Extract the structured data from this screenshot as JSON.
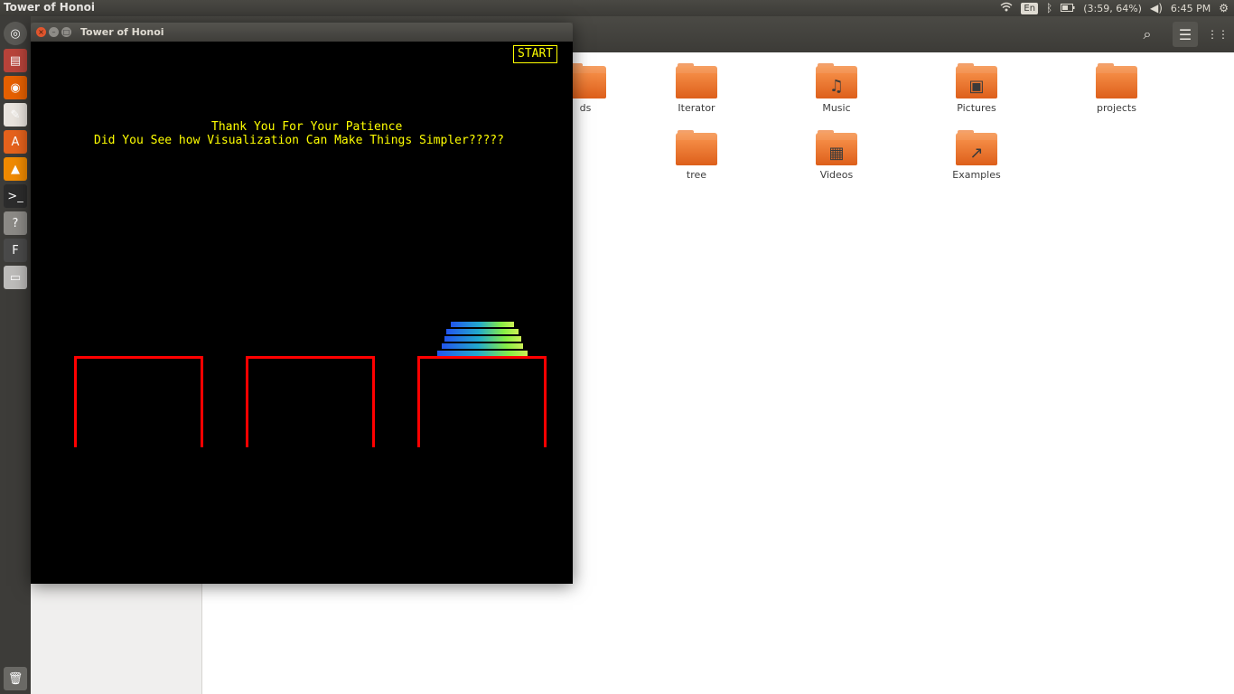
{
  "top_panel": {
    "app_title": "Tower of Honoi",
    "keyboard_layout": "En",
    "battery": "(3:59, 64%)",
    "time": "6:45 PM",
    "icons": [
      "wifi-icon",
      "bluetooth-icon",
      "battery-icon",
      "volume-icon",
      "settings-gear-icon"
    ]
  },
  "launcher": {
    "items": [
      {
        "name": "dash-home",
        "glyph": "◎",
        "color": "#5a5955"
      },
      {
        "name": "files",
        "glyph": "▤",
        "color": "#b8433a"
      },
      {
        "name": "firefox",
        "glyph": "◉",
        "color": "#e66000"
      },
      {
        "name": "libreoffice",
        "glyph": "✎",
        "color": "#e9e4de"
      },
      {
        "name": "software-center",
        "glyph": "A",
        "color": "#e6621c"
      },
      {
        "name": "vlc",
        "glyph": "▲",
        "color": "#f08a00"
      },
      {
        "name": "terminal",
        "glyph": ">_",
        "color": "#2c2c2c"
      },
      {
        "name": "help",
        "glyph": "?",
        "color": "#8c8a86"
      },
      {
        "name": "flash",
        "glyph": "F",
        "color": "#4a4a4a"
      },
      {
        "name": "drive",
        "glyph": "▭",
        "color": "#bdbcba"
      }
    ],
    "trash": {
      "glyph": "🗑"
    }
  },
  "files": {
    "folders": [
      {
        "label": "ds",
        "emblem": ""
      },
      {
        "label": "Iterator",
        "emblem": ""
      },
      {
        "label": "Music",
        "emblem": "♫"
      },
      {
        "label": "Pictures",
        "emblem": "▣"
      },
      {
        "label": "projects",
        "emblem": ""
      },
      {
        "label": "tree",
        "emblem": ""
      },
      {
        "label": "Videos",
        "emblem": "▦"
      },
      {
        "label": "Examples",
        "emblem": "↗"
      }
    ],
    "toolbar": {
      "search_icon": "⌕",
      "menu_icon": "☰",
      "grid_icon": "⋮⋮"
    }
  },
  "tower_window": {
    "title": "Tower of Honoi",
    "start_label": "START",
    "message_line1": "Thank You For Your Patience",
    "message_line2": "Did You See how Visualization Can Make Things Simpler?????",
    "pegs": 3,
    "disks_on_peg": [
      0,
      0,
      5
    ]
  }
}
